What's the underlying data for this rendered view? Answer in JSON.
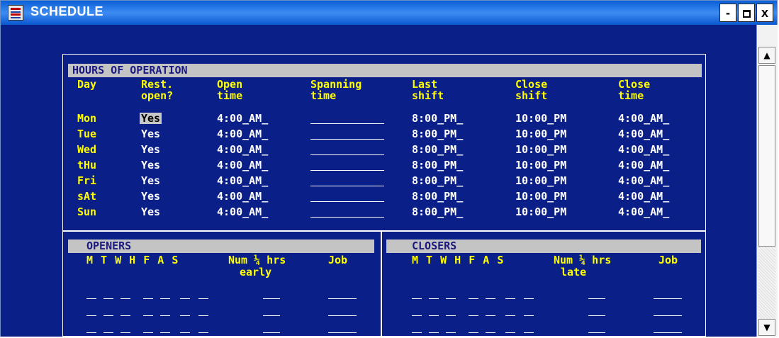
{
  "window": {
    "title": "SCHEDULE",
    "icon": "schedule-app-icon",
    "controls": {
      "minimize": "-",
      "close": "x"
    }
  },
  "hours": {
    "section_title": "HOURS OF OPERATION",
    "headers": {
      "day": "Day",
      "rest_1": "Rest.",
      "rest_2": "open?",
      "open_1": "Open",
      "open_2": "time",
      "span_1": "Spanning",
      "span_2": "time",
      "last_1": "Last",
      "last_2": "shift",
      "cshift_1": "Close",
      "cshift_2": "shift",
      "ctime_1": "Close",
      "ctime_2": "time"
    },
    "rows": [
      {
        "day": "Mon",
        "open": "Yes",
        "open_time": "4:00_AM_",
        "last_shift": "8:00_PM_",
        "close_shift": "10:00_PM",
        "close_time": "4:00_AM_"
      },
      {
        "day": "Tue",
        "open": "Yes",
        "open_time": "4:00_AM_",
        "last_shift": "8:00_PM_",
        "close_shift": "10:00_PM",
        "close_time": "4:00_AM_"
      },
      {
        "day": "Wed",
        "open": "Yes",
        "open_time": "4:00_AM_",
        "last_shift": "8:00_PM_",
        "close_shift": "10:00_PM",
        "close_time": "4:00_AM_"
      },
      {
        "day": "tHu",
        "open": "Yes",
        "open_time": "4:00_AM_",
        "last_shift": "8:00_PM_",
        "close_shift": "10:00_PM",
        "close_time": "4:00_AM_"
      },
      {
        "day": "Fri",
        "open": "Yes",
        "open_time": "4:00_AM_",
        "last_shift": "8:00_PM_",
        "close_shift": "10:00_PM",
        "close_time": "4:00_AM_"
      },
      {
        "day": "sAt",
        "open": "Yes",
        "open_time": "4:00_AM_",
        "last_shift": "8:00_PM_",
        "close_shift": "10:00_PM",
        "close_time": "4:00_AM_"
      },
      {
        "day": "Sun",
        "open": "Yes",
        "open_time": "4:00_AM_",
        "last_shift": "8:00_PM_",
        "close_shift": "10:00_PM",
        "close_time": "4:00_AM_"
      }
    ]
  },
  "openers": {
    "section_title": "OPENERS",
    "days": "M T W H F A S",
    "num_label": "Num ¼ hrs",
    "num_sub": "early",
    "job_label": "Job"
  },
  "closers": {
    "section_title": "CLOSERS",
    "days": "M T W H F A S",
    "num_label": "Num ¼ hrs",
    "num_sub": "late",
    "job_label": "Job"
  }
}
